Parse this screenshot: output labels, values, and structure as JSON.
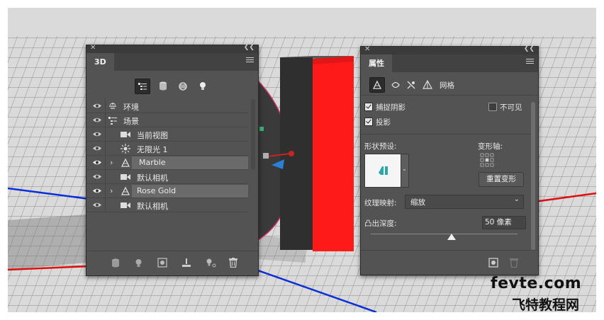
{
  "panel3d": {
    "tab_label": "3D",
    "layers": [
      {
        "label": "环境",
        "icon": "environment-icon",
        "visible": true
      },
      {
        "label": "场景",
        "icon": "scene-icon",
        "visible": true
      },
      {
        "label": "当前视图",
        "icon": "camera-icon",
        "visible": true
      },
      {
        "label": "无限光 1",
        "icon": "infinite-light-icon",
        "visible": true
      },
      {
        "label": "Marble",
        "icon": "mesh-icon",
        "visible": true,
        "highlighted": true,
        "expandable": true
      },
      {
        "label": "默认相机",
        "icon": "camera-icon",
        "visible": true
      },
      {
        "label": "Rose Gold",
        "icon": "mesh-icon",
        "visible": true,
        "highlighted": true,
        "expandable": true
      },
      {
        "label": "默认相机",
        "icon": "camera-icon",
        "visible": true
      }
    ],
    "filter_icons": [
      "whole-scene-filter-icon",
      "meshes-filter-icon",
      "materials-filter-icon",
      "lights-filter-icon"
    ],
    "footer_icons": [
      "render-icon",
      "light-bulb-icon",
      "add-object-icon",
      "ground-icon",
      "new-light-icon",
      "delete-icon"
    ]
  },
  "properties": {
    "tab_label": "属性",
    "mesh_tab_label": "网格",
    "catch_shadows_label": "捕捉阴影",
    "catch_shadows_checked": true,
    "invisible_label": "不可见",
    "invisible_checked": false,
    "cast_shadows_label": "投影",
    "cast_shadows_checked": true,
    "shape_preset_label": "形状预设:",
    "deform_axis_label": "变形轴:",
    "reset_deform_label": "重置变形",
    "texture_mapping_label": "纹理映射:",
    "texture_mapping_value": "缩放",
    "extrusion_depth_label": "凸出深度:",
    "extrusion_depth_value": "50 像素",
    "extrusion_slider_fraction": 0.55
  },
  "watermark": {
    "line1": "fevte.com",
    "line2": "飞特教程网"
  },
  "colors": {
    "panel_bg": "#535353",
    "highlight_row": "#6a6a6a",
    "extrusion_red": "#ff1a1a",
    "axis_red": "#e01010",
    "axis_blue": "#0a2fd8",
    "gizmo_blue": "#2a7fd6"
  }
}
